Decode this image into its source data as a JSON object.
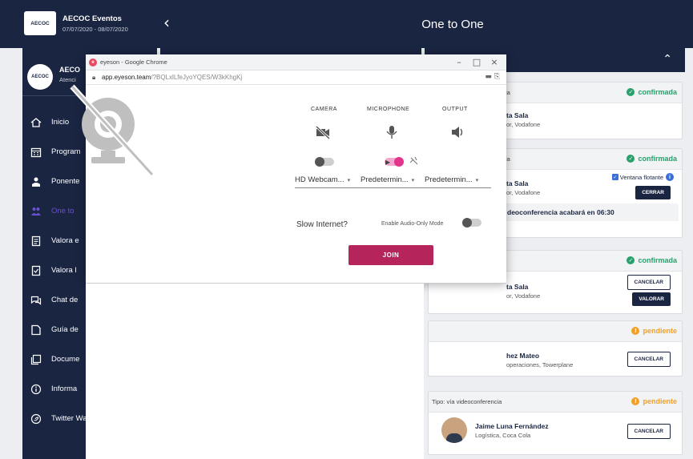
{
  "topbar": {
    "brand_logo": "AECOC",
    "brand_title": "AECOC Eventos",
    "brand_dates": "07/07/2020 - 08/07/2020",
    "back_icon": "chevron-left-icon",
    "page_title": "One to One"
  },
  "sidebar": {
    "user_avatar": "AECOC",
    "user_name": "AECO",
    "user_role": "Atenci",
    "items": [
      {
        "label": "Inicio",
        "icon": "home-icon"
      },
      {
        "label": "Program",
        "icon": "calendar-icon"
      },
      {
        "label": "Ponente",
        "icon": "speaker-icon"
      },
      {
        "label": "One to",
        "icon": "people-icon"
      },
      {
        "label": "Valora e",
        "icon": "clipboard-icon"
      },
      {
        "label": "Valora l",
        "icon": "clipboard-check-icon"
      },
      {
        "label": "Chat de",
        "icon": "chat-icon"
      },
      {
        "label": "Guía de",
        "icon": "book-icon"
      },
      {
        "label": "Docume",
        "icon": "document-icon"
      },
      {
        "label": "Informa",
        "icon": "info-icon"
      },
      {
        "label": "Twitter Wall",
        "icon": "twitter-icon"
      }
    ]
  },
  "panel": {
    "chevron": "chevron-up-icon",
    "cards": [
      {
        "type": "ia",
        "status": "confirmada",
        "name": "ta Sala",
        "org": "or, Vodafone"
      },
      {
        "type": "ia",
        "status": "confirmada",
        "name": "ta Sala",
        "org": "or, Vodafone",
        "float_label": "Ventana flotante",
        "button": "CERRAR",
        "notice": "deoconferencia acabará en 06:30"
      },
      {
        "type": "",
        "status": "confirmada",
        "name": "ta Sala",
        "org": "or, Vodafone",
        "button1": "CANCELAR",
        "button2": "VALORAR"
      },
      {
        "type": "",
        "status": "pendiente",
        "name": "hez Mateo",
        "org": "operaciones, Towerplane",
        "button": "CANCELAR"
      },
      {
        "type": "Tipo: vía videoconferencia",
        "status": "pendiente",
        "name": "Jaime Luna Fernández",
        "org": "Logística, Coca Cola",
        "button": "CANCELAR"
      }
    ]
  },
  "popup": {
    "window_title": "eyeson - Google Chrome",
    "url_host": "app.eyeson.team",
    "url_path": "/?BQLxlLfeJyoYQES/W3kKhgKj",
    "camera_label": "CAMERA",
    "microphone_label": "MICROPHONE",
    "output_label": "OUTPUT",
    "camera_select": "HD Webcam...",
    "mic_select": "Predetermin...",
    "output_select": "Predetermin...",
    "slow_internet": "Slow Internet?",
    "audio_only": "Enable Audio-Only Mode",
    "join": "JOIN",
    "camera_toggle": false,
    "mic_toggle": true,
    "audio_only_toggle": false
  },
  "colors": {
    "navy": "#1a2542",
    "confirmed": "#28a06b",
    "pending": "#f0a02a",
    "join": "#b5245b",
    "toggle_on": "#e3348c"
  }
}
